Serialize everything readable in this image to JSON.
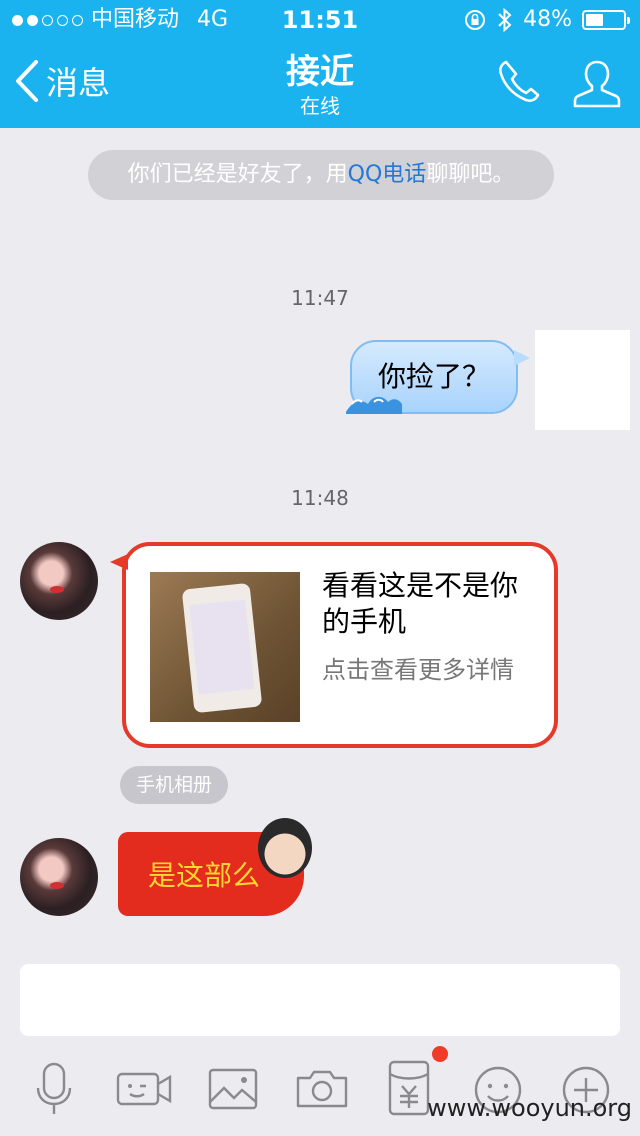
{
  "status_bar": {
    "carrier": "中国移动",
    "network": "4G",
    "time": "11:51",
    "battery": "48%",
    "battery_level": 0.48,
    "signal_bars_filled": 2,
    "signal_bars_total": 5
  },
  "header": {
    "back_label": "消息",
    "title": "接近",
    "subtitle": "在线",
    "icons": [
      "phone-icon",
      "profile-icon"
    ]
  },
  "chat": {
    "system_tip": {
      "prefix": "你们已经是好友了，用",
      "link": "QQ电话",
      "suffix": "聊聊吧。"
    },
    "timestamps": [
      "11:47",
      "11:48"
    ],
    "outgoing_message": "你捡了？",
    "card": {
      "title": "看看这是不是你的手机",
      "subtitle": "点击查看更多详情"
    },
    "album_tag": "手机相册",
    "red_message": "是这部么"
  },
  "watermark": "www.wooyun.org",
  "colors": {
    "header_bg": "#1ab3f0",
    "chat_bg": "#ebebf0",
    "card_border": "#e53a2a",
    "link": "#2378d8"
  },
  "toolbar_icons": [
    "microphone-icon",
    "video-icon",
    "image-icon",
    "camera-icon",
    "red-packet-icon",
    "emoji-icon",
    "plus-icon"
  ]
}
